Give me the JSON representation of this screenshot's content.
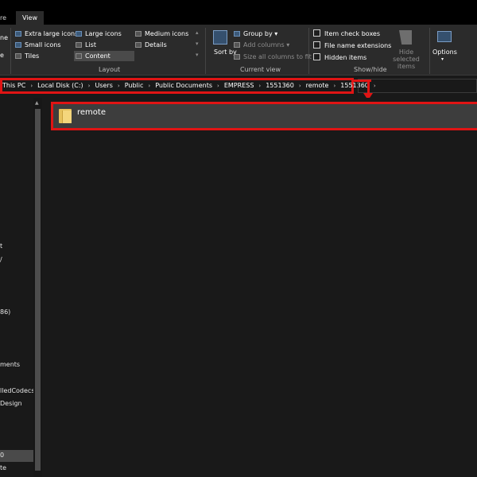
{
  "tabs": {
    "partial": "re",
    "view": "View"
  },
  "ribbon": {
    "pane_partial": [
      "ne",
      "e"
    ],
    "layout": {
      "items": [
        "Extra large icons",
        "Large icons",
        "Medium icons",
        "Small icons",
        "List",
        "Details",
        "Tiles",
        "Content"
      ],
      "selected": "Content",
      "label": "Layout"
    },
    "current_view": {
      "sort_by": "Sort by",
      "group_by": "Group by",
      "add_columns": "Add columns",
      "size_all_columns": "Size all columns to fit",
      "label": "Current view"
    },
    "show_hide": {
      "item_check_boxes": "Item check boxes",
      "file_name_extensions": "File name extensions",
      "hidden_items": "Hidden items",
      "hide_selected_items": "Hide selected items",
      "label": "Show/hide"
    },
    "options": "Options"
  },
  "address": {
    "crumbs": [
      "This PC",
      "Local Disk (C:)",
      "Users",
      "Public",
      "Public Documents",
      "EMPRESS",
      "1551360",
      "remote",
      "1551360"
    ]
  },
  "nav": {
    "items": [
      {
        "label": "t"
      },
      {
        "label": "/"
      },
      {
        "label": "86)"
      },
      {
        "label": "ments"
      },
      {
        "label": "lledCodecs"
      },
      {
        "label": "Design"
      },
      {
        "label": "0"
      },
      {
        "label": "te"
      }
    ]
  },
  "content": {
    "items": [
      {
        "name": "remote"
      }
    ]
  },
  "colors": {
    "highlight": "#e01414",
    "background": "#191919",
    "ribbon": "#2b2b2b",
    "folder": "#e7c25c"
  },
  "icons": [
    "folder-icon",
    "chevron-right-icon",
    "sort-icon",
    "options-icon",
    "hide-selected-icon"
  ]
}
